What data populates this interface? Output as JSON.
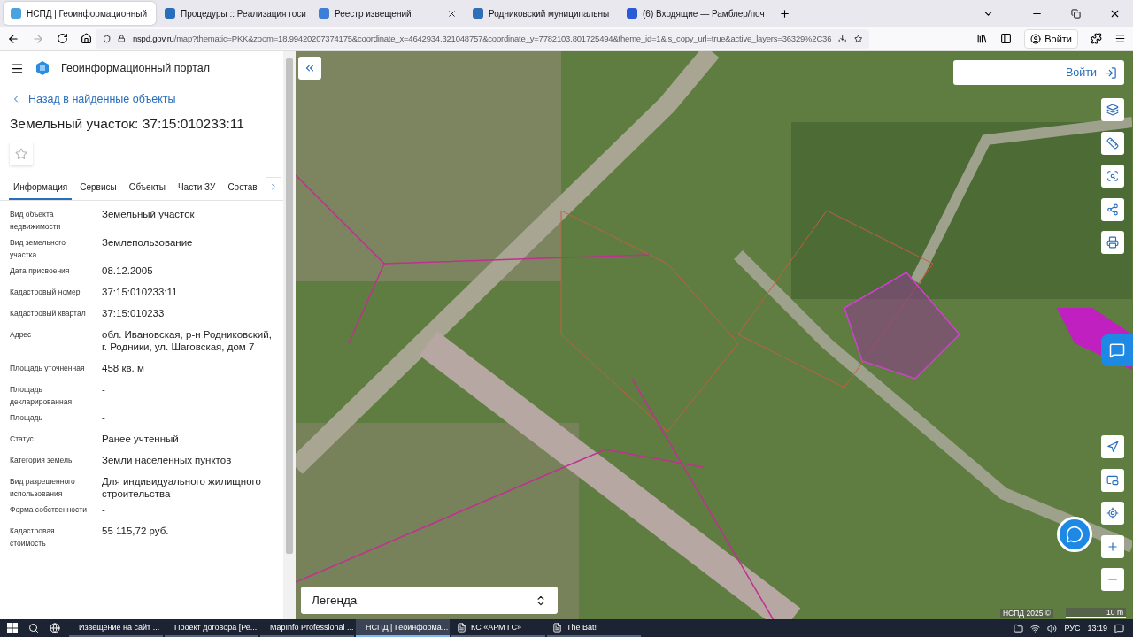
{
  "browser": {
    "tabs": [
      {
        "title": "НСПД | Геоинформационный",
        "selected": true
      },
      {
        "title": "Процедуры :: Реализация госи",
        "selected": false
      },
      {
        "title": "Реестр извещений",
        "selected": false
      },
      {
        "title": "Родниковский муниципальны",
        "selected": false
      },
      {
        "title": "(6) Входящие — Рамблер/поч",
        "selected": false
      }
    ],
    "url_host": "nspd.gov.ru",
    "url_path": "/map?thematic=PKK&zoom=18.99420207374175&coordinate_x=4642934.321048757&coordinate_y=7782103.801725494&theme_id=1&is_copy_url=true&active_layers=36329%2C36",
    "signin": "Войти"
  },
  "portal": {
    "brand": "Геоинформационный портал",
    "back_link": "Назад в найденные объекты",
    "title": "Земельный участок: 37:15:010233:11",
    "tabs": [
      {
        "label": "Информация",
        "selected": true
      },
      {
        "label": "Сервисы",
        "selected": false
      },
      {
        "label": "Объекты",
        "selected": false
      },
      {
        "label": "Части ЗУ",
        "selected": false
      },
      {
        "label": "Состав",
        "selected": false
      }
    ],
    "properties": [
      {
        "label": "Вид объекта недвижимости",
        "value": "Земельный участок"
      },
      {
        "label": "Вид земельного участка",
        "value": "Землепользование"
      },
      {
        "label": "Дата присвоения",
        "value": "08.12.2005"
      },
      {
        "label": "Кадастровый номер",
        "value": "37:15:010233:11"
      },
      {
        "label": "Кадастровый квартал",
        "value": "37:15:010233"
      },
      {
        "label": "Адрес",
        "value": "обл. Ивановская, р-н Родниковский, г. Родники, ул. Шаговская, дом 7"
      },
      {
        "label": "Площадь уточненная",
        "value": "458 кв. м"
      },
      {
        "label": "Площадь декларированная",
        "value": "-"
      },
      {
        "label": "Площадь",
        "value": "-"
      },
      {
        "label": "Статус",
        "value": "Ранее учтенный"
      },
      {
        "label": "Категория земель",
        "value": "Земли населенных пунктов"
      },
      {
        "label": "Вид разрешенного использования",
        "value": "Для индивидуального жилищного строительства"
      },
      {
        "label": "Форма собственности",
        "value": "-"
      },
      {
        "label": "Кадастровая стоимость",
        "value": "55 115,72 руб."
      }
    ]
  },
  "map": {
    "login": "Войти",
    "legend": "Легенда",
    "attribution": "НСПД 2025 ©",
    "scale": "10 m"
  },
  "taskbar": {
    "items": [
      {
        "label": "Извещение на сайт ...",
        "selected": false
      },
      {
        "label": "Проект договора [Ре...",
        "selected": false
      },
      {
        "label": "MapInfo Professional ...",
        "selected": false
      },
      {
        "label": "НСПД | Геоинформа...",
        "selected": true
      },
      {
        "label": "КС «АРМ ГС»",
        "selected": false
      },
      {
        "label": "The Bat!",
        "selected": false
      }
    ],
    "language": "РУС",
    "time": "13:19"
  }
}
